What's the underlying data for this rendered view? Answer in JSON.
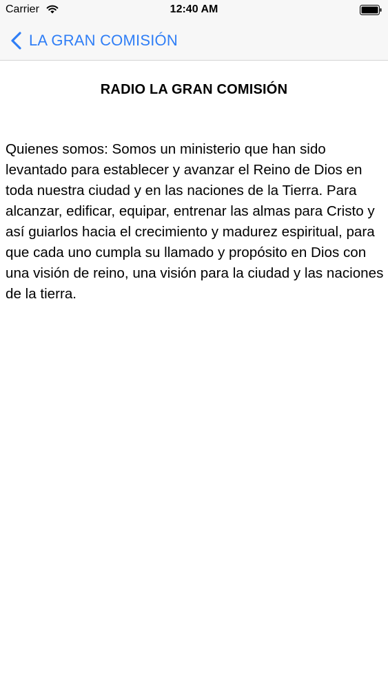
{
  "status_bar": {
    "carrier": "Carrier",
    "time": "12:40 AM",
    "icons": [
      "wifi-icon",
      "battery-icon"
    ]
  },
  "nav": {
    "back_label": "LA GRAN COMISIÓN",
    "back_icon": "chevron-left-icon",
    "accent_color": "#2f7ef6"
  },
  "page": {
    "title": "RADIO LA GRAN COMISIÓN",
    "body": "Quienes somos: Somos un ministerio que han sido levantado para establecer y avanzar el Reino de Dios en toda nuestra ciudad y en las naciones de la Tierra. Para alcanzar, edificar, equipar, entrenar las almas para Cristo y así guiarlos hacia el crecimiento y madurez espiritual, para que cada uno cumpla su llamado y propósito en Dios con una visión de reino, una visión para la ciudad y las naciones de la tierra."
  }
}
